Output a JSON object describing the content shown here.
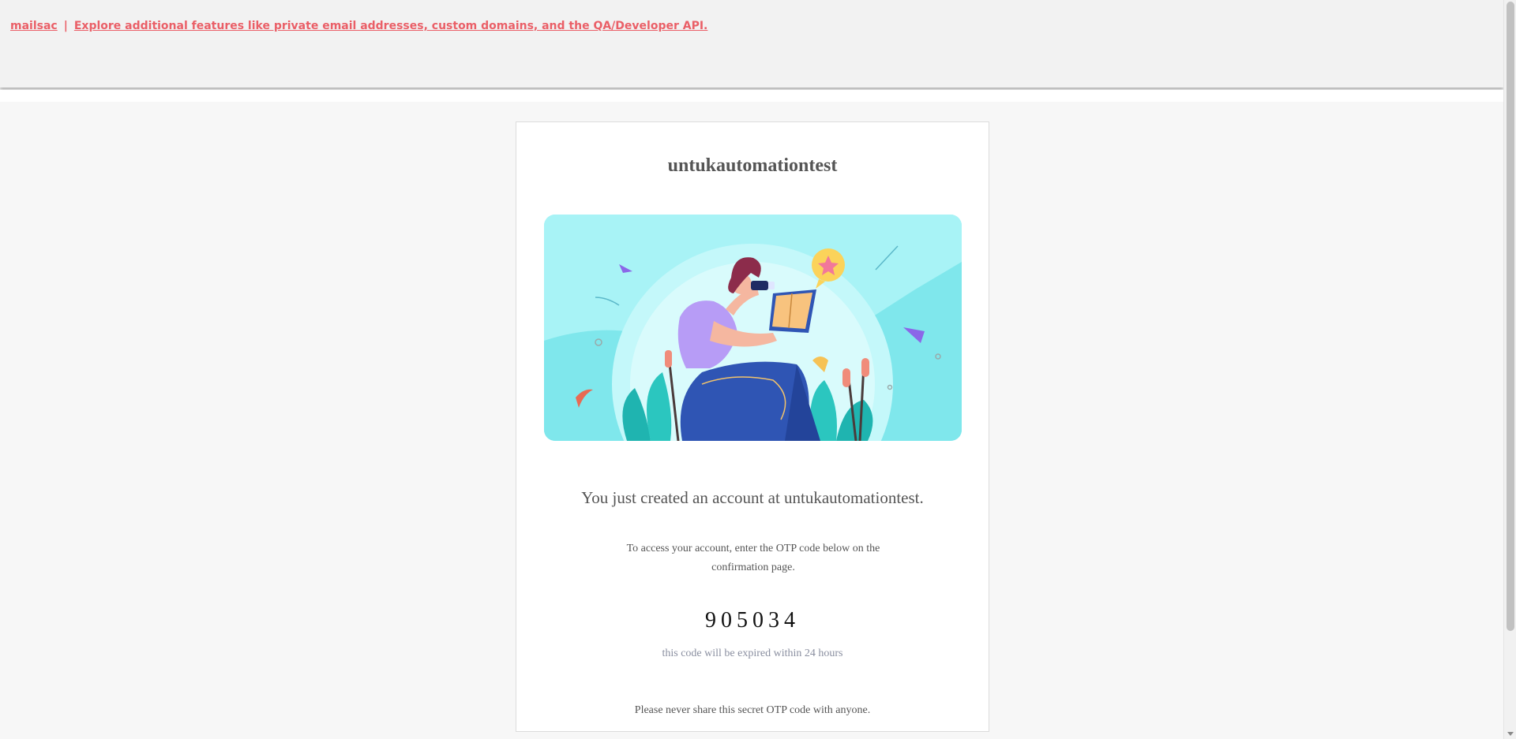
{
  "header": {
    "brand_link": "mailsac",
    "separator": "|",
    "promo_link": "Explore additional features like private email addresses, custom domains, and the QA/Developer API.",
    "link_color": "#ea5f67"
  },
  "email": {
    "title": "untukautomationtest",
    "hero_image": "woman-reading-book-illustration",
    "headline": "You just created an account at untukautomationtest.",
    "instructions": "To access your account, enter the OTP code below on the confirmation page.",
    "otp_code": "905034",
    "expiry_note": "this code will be expired within 24 hours",
    "warning": "Please never share this secret OTP code with anyone."
  },
  "colors": {
    "hero_bg": "#a8f3f6",
    "accent_purple": "#a78bfa",
    "accent_blue": "#2f55b4",
    "accent_coral": "#f08c7a"
  }
}
